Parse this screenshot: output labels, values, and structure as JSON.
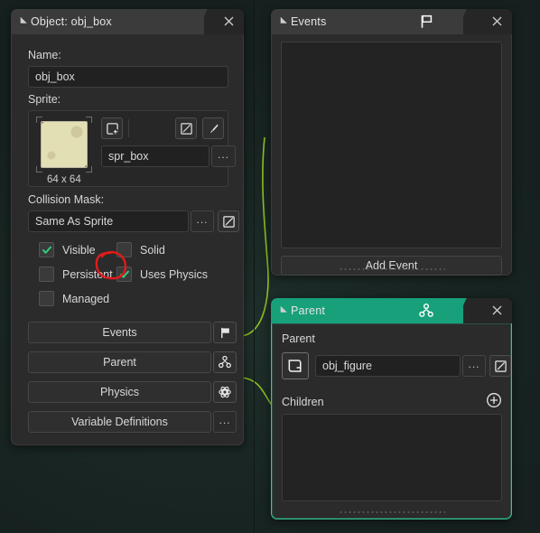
{
  "workspace": {
    "background_color": "#1a2724",
    "accent_teal": "#17a07a",
    "connector_color": "#8fbf1f",
    "annotation_color": "#e01b1b"
  },
  "object_panel": {
    "title": "Object: obj_box",
    "collapse_icon": "collapse-triangle-icon",
    "close_icon": "close-icon",
    "name_label": "Name:",
    "name_value": "obj_box",
    "sprite_label": "Sprite:",
    "sprite_name": "spr_box",
    "sprite_size": "64 x 64",
    "sprite_dots": "...",
    "new_sprite_icon": "new-sprite-icon",
    "edit_sprite_icon": "edit-image-icon",
    "paint_sprite_icon": "paintbrush-icon",
    "collision_label": "Collision Mask:",
    "collision_value": "Same As Sprite",
    "collision_dots": "...",
    "collision_edit_icon": "edit-collision-mask-icon",
    "checkboxes": [
      {
        "label": "Visible",
        "checked": true,
        "name": "visible"
      },
      {
        "label": "Solid",
        "checked": false,
        "name": "solid"
      },
      {
        "label": "Persistent",
        "checked": false,
        "name": "persistent"
      },
      {
        "label": "Uses Physics",
        "checked": true,
        "name": "uses-physics"
      },
      {
        "label": "Managed",
        "checked": false,
        "name": "managed"
      }
    ],
    "buttons": [
      {
        "label": "Events",
        "icon": "flag-icon",
        "name": "events"
      },
      {
        "label": "Parent",
        "icon": "hierarchy-icon",
        "name": "parent"
      },
      {
        "label": "Physics",
        "icon": "atom-icon",
        "name": "physics"
      },
      {
        "label": "Variable Definitions",
        "icon": "ellipsis-icon",
        "name": "variable-definitions"
      }
    ],
    "variable_definitions_dots": "..."
  },
  "events_panel": {
    "title": "Events",
    "header_icon": "flag-icon",
    "close_icon": "close-icon",
    "add_event_label": "Add Event",
    "events": []
  },
  "parent_panel": {
    "title": "Parent",
    "header_icon": "hierarchy-icon",
    "close_icon": "close-icon",
    "parent_label": "Parent",
    "parent_value": "obj_figure",
    "parent_dots": "...",
    "parent_object_icon": "object-icon",
    "parent_edit_icon": "edit-object-icon",
    "children_label": "Children",
    "children_add_icon": "plus-circle-icon",
    "children": []
  }
}
